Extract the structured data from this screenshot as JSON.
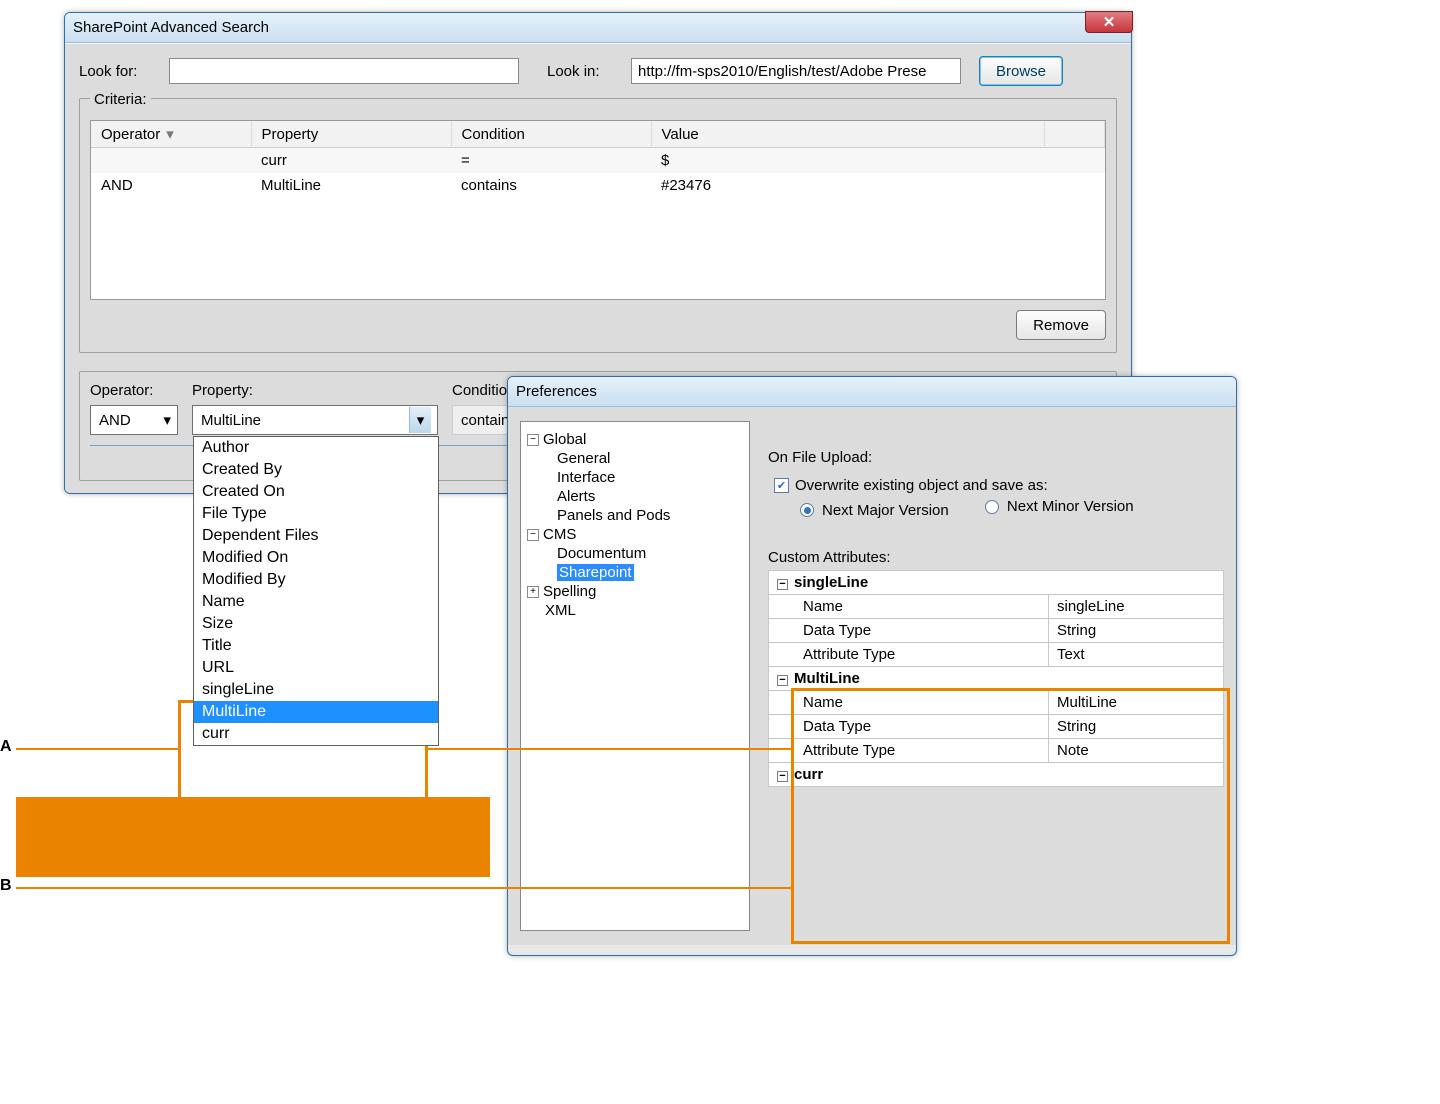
{
  "dlg1": {
    "title": "SharePoint Advanced Search",
    "look_for_label": "Look for:",
    "look_for_value": "",
    "look_in_label": "Look in:",
    "look_in_value": "http://fm-sps2010/English/test/Adobe Prese",
    "browse": "Browse",
    "criteria_label": "Criteria:",
    "cols": {
      "op": "Operator",
      "prop": "Property",
      "cond": "Condition",
      "val": "Value"
    },
    "rows": [
      {
        "op": "",
        "prop": "curr",
        "cond": "=",
        "val": "$"
      },
      {
        "op": "AND",
        "prop": "MultiLine",
        "cond": "contains",
        "val": "#23476"
      }
    ],
    "remove": "Remove",
    "builder": {
      "op_label": "Operator:",
      "prop_label": "Property:",
      "cond_label": "Condition:",
      "op_value": "AND",
      "prop_value": "MultiLine",
      "cond_value": "contains"
    },
    "dropdown_items": [
      "Author",
      "Created By",
      "Created On",
      "File Type",
      "Dependent Files",
      "Modified On",
      "Modified By",
      "Name",
      "Size",
      "Title",
      "URL",
      "singleLine",
      "MultiLine",
      "curr"
    ],
    "dropdown_selected": "MultiLine"
  },
  "dlg2": {
    "title": "Preferences",
    "tree": {
      "global": "Global",
      "general": "General",
      "interface": "Interface",
      "alerts": "Alerts",
      "panels": "Panels and Pods",
      "cms": "CMS",
      "documentum": "Documentum",
      "sharepoint": "Sharepoint",
      "spelling": "Spelling",
      "xml": "XML"
    },
    "upload_label": "On File Upload:",
    "overwrite": "Overwrite existing object and save as:",
    "major": "Next Major Version",
    "minor": "Next Minor Version",
    "custom_attr_label": "Custom Attributes:",
    "attrs": [
      {
        "section": "singleLine",
        "Name": "singleLine",
        "DataType": "String",
        "AttributeType": "Text"
      },
      {
        "section": "MultiLine",
        "Name": "MultiLine",
        "DataType": "String",
        "AttributeType": "Note"
      },
      {
        "section": "curr"
      }
    ],
    "labels": {
      "name": "Name",
      "dtype": "Data Type",
      "atype": "Attribute Type"
    }
  },
  "callouts": {
    "a": "A",
    "b": "B"
  }
}
